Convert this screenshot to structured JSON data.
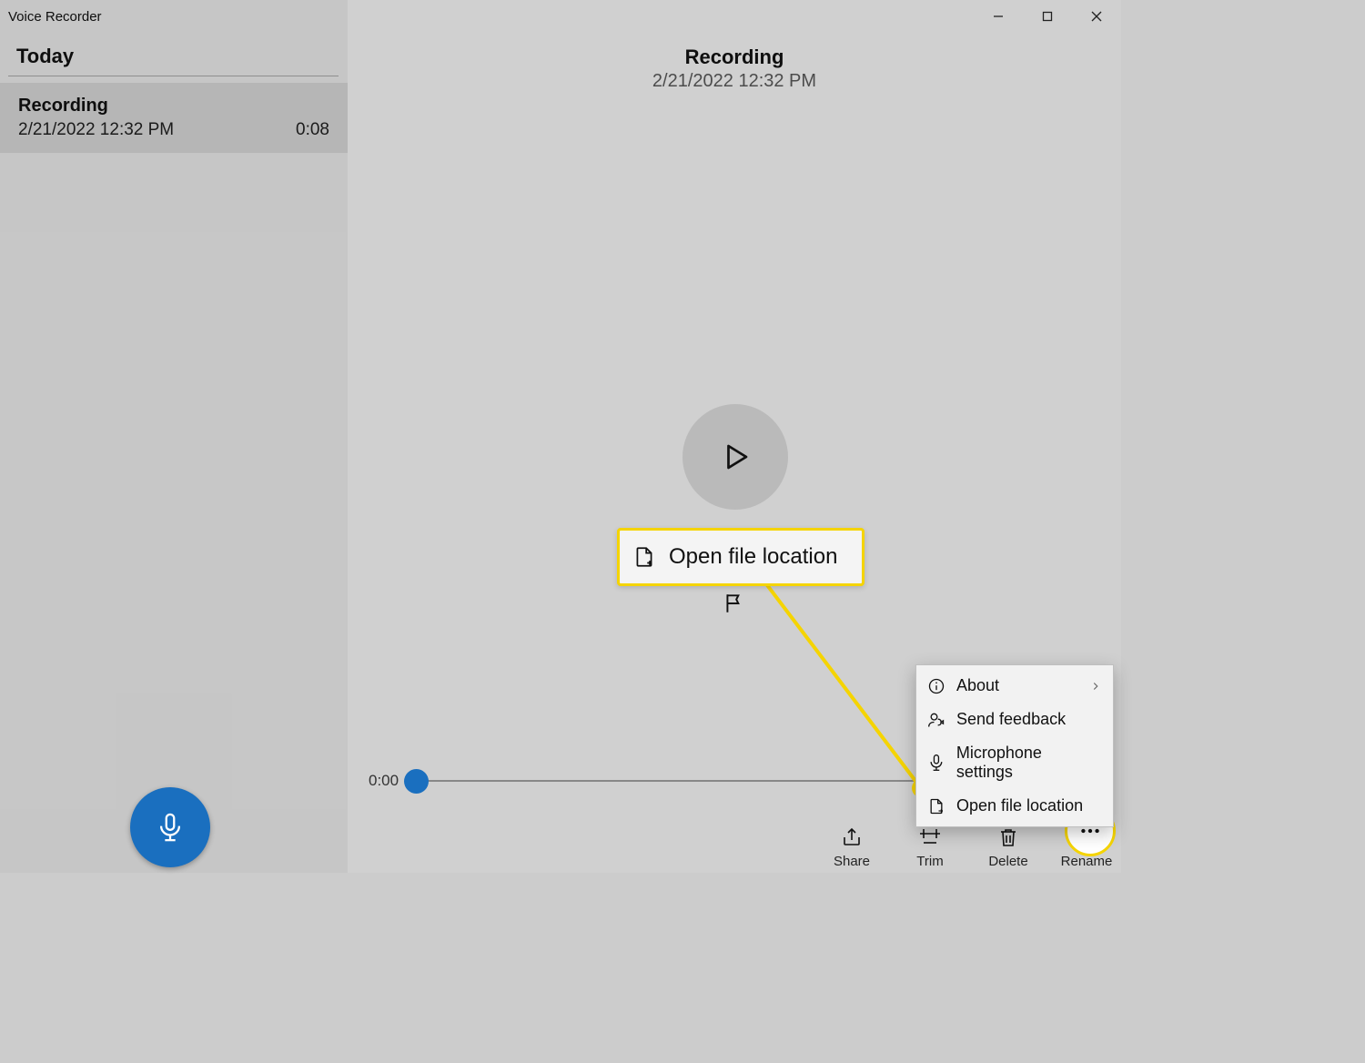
{
  "app": {
    "title": "Voice Recorder"
  },
  "sidebar": {
    "group_label": "Today",
    "item": {
      "title": "Recording",
      "datetime": "2/21/2022 12:32 PM",
      "duration": "0:08"
    }
  },
  "main": {
    "title": "Recording",
    "datetime": "2/21/2022 12:32 PM",
    "timeline_start": "0:00"
  },
  "callout": {
    "label": "Open file location"
  },
  "toolbar": {
    "share": "Share",
    "trim": "Trim",
    "delete": "Delete",
    "rename": "Rename"
  },
  "menu": {
    "about": "About",
    "feedback": "Send feedback",
    "mic": "Microphone settings",
    "open": "Open file location"
  }
}
